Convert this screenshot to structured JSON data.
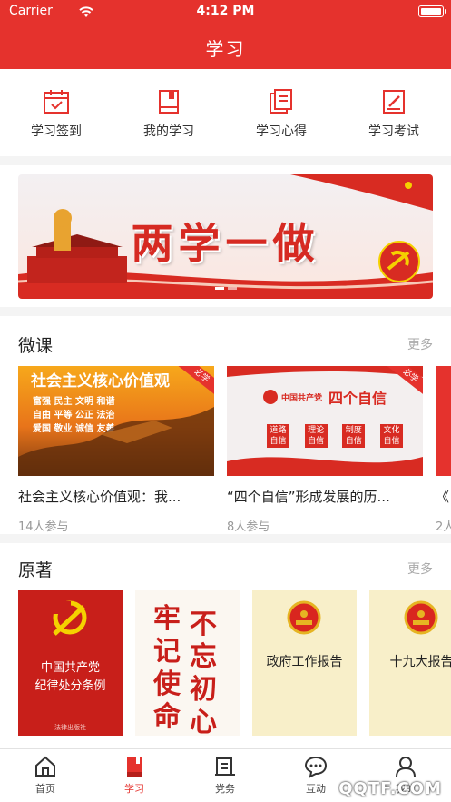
{
  "status_bar": {
    "carrier": "Carrier",
    "time": "4:12 PM"
  },
  "header": {
    "title": "学习"
  },
  "quick_actions": [
    {
      "label": "学习签到",
      "icon": "calendar-check-icon"
    },
    {
      "label": "我的学习",
      "icon": "book-icon"
    },
    {
      "label": "学习心得",
      "icon": "notes-icon"
    },
    {
      "label": "学习考试",
      "icon": "exam-edit-icon"
    }
  ],
  "banner": {
    "title": "两学一做",
    "page_count": 2,
    "active_page": 1
  },
  "micro_course": {
    "title": "微课",
    "more": "更多",
    "items": [
      {
        "title": "社会主义核心价值观：我...",
        "meta": "14人参与",
        "badge": "必学",
        "thumb_heading": "社会主义核心价值观",
        "thumb_lines": [
          "富强 民主 文明 和谐",
          "自由 平等 公正 法治",
          "爱国 敬业 诚信 友善"
        ]
      },
      {
        "title": "“四个自信”形成发展的历...",
        "meta": "8人参与",
        "badge": "必学",
        "thumb_party": "中国共产党",
        "thumb_heading": "四个自信",
        "thumb_boxes": [
          "道路自信",
          "理论自信",
          "制度自信",
          "文化自信"
        ]
      },
      {
        "title": "《",
        "meta": "2人"
      }
    ]
  },
  "original_works": {
    "title": "原著",
    "more": "更多",
    "books": [
      {
        "title": "中国共产党纪律处分条例",
        "line1": "中国共产党",
        "line2": "纪律处分条例",
        "publisher": "法律出版社"
      },
      {
        "title": "不忘初心 牢记使命",
        "col1": "牢记使命",
        "col2": "不忘初心"
      },
      {
        "title": "政府工作报告"
      },
      {
        "title": "十九大报告"
      }
    ]
  },
  "tabbar": {
    "items": [
      {
        "label": "首页",
        "icon": "home-icon",
        "active": false
      },
      {
        "label": "学习",
        "icon": "study-book-icon",
        "active": true
      },
      {
        "label": "党务",
        "icon": "party-affairs-icon",
        "active": false
      },
      {
        "label": "互动",
        "icon": "chat-icon",
        "active": false
      },
      {
        "label": "我的",
        "icon": "user-icon",
        "active": false
      }
    ]
  },
  "watermark": "QQTF.COM",
  "colors": {
    "brand_red": "#e5322d",
    "gold": "#f5d100",
    "muted_text": "#999999"
  }
}
